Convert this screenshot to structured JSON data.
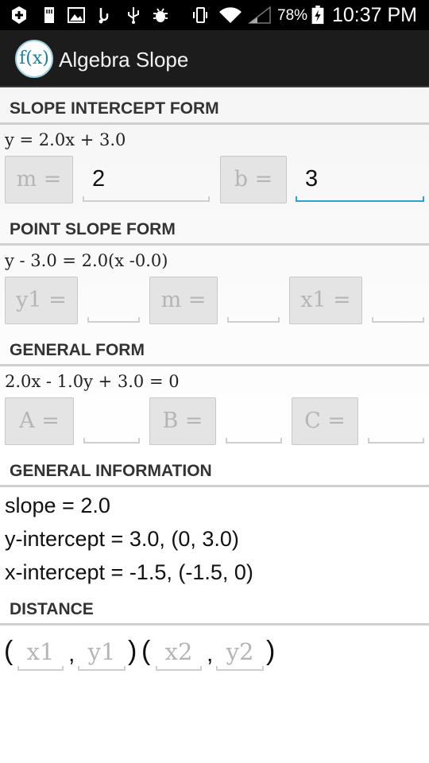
{
  "status_bar": {
    "battery_percent": "78%",
    "time": "10:37 PM",
    "icons": [
      "add-icon",
      "sd-card-icon",
      "image-icon",
      "usb-debug-icon",
      "usb-icon",
      "bug-icon",
      "vibrate-icon",
      "wifi-icon",
      "signal-icon",
      "battery-charging-icon"
    ]
  },
  "action_bar": {
    "logo_text": "f(x)",
    "title": "Algebra Slope"
  },
  "slope_intercept": {
    "header": "SLOPE INTERCEPT FORM",
    "equation": "y = 2.0x + 3.0",
    "m_label": "m =",
    "m_value": "2",
    "b_label": "b =",
    "b_value": "3"
  },
  "point_slope": {
    "header": "POINT SLOPE FORM",
    "equation": "y - 3.0 = 2.0(x -0.0)",
    "y1_label": "y1 =",
    "y1_value": "",
    "m_label": "m =",
    "m_value": "",
    "x1_label": "x1 =",
    "x1_value": ""
  },
  "general_form": {
    "header": "GENERAL FORM",
    "equation": "2.0x - 1.0y + 3.0 = 0",
    "a_label": "A =",
    "a_value": "",
    "b_label": "B =",
    "b_value": "",
    "c_label": "C =",
    "c_value": ""
  },
  "general_info": {
    "header": "GENERAL INFORMATION",
    "slope": "slope = 2.0",
    "y_intercept": "y-intercept = 3.0, (0, 3.0)",
    "x_intercept": "x-intercept = -1.5, (-1.5, 0)"
  },
  "distance": {
    "header": "DISTANCE",
    "open_paren": "(",
    "close_paren": ")",
    "comma": ",",
    "x1_hint": "x1",
    "y1_hint": "y1",
    "x2_hint": "x2",
    "y2_hint": "y2"
  },
  "colors": {
    "focus_underline": "#2aa3d4",
    "action_bar": "#1c1c1c",
    "label_box": "#e4e4e4"
  }
}
